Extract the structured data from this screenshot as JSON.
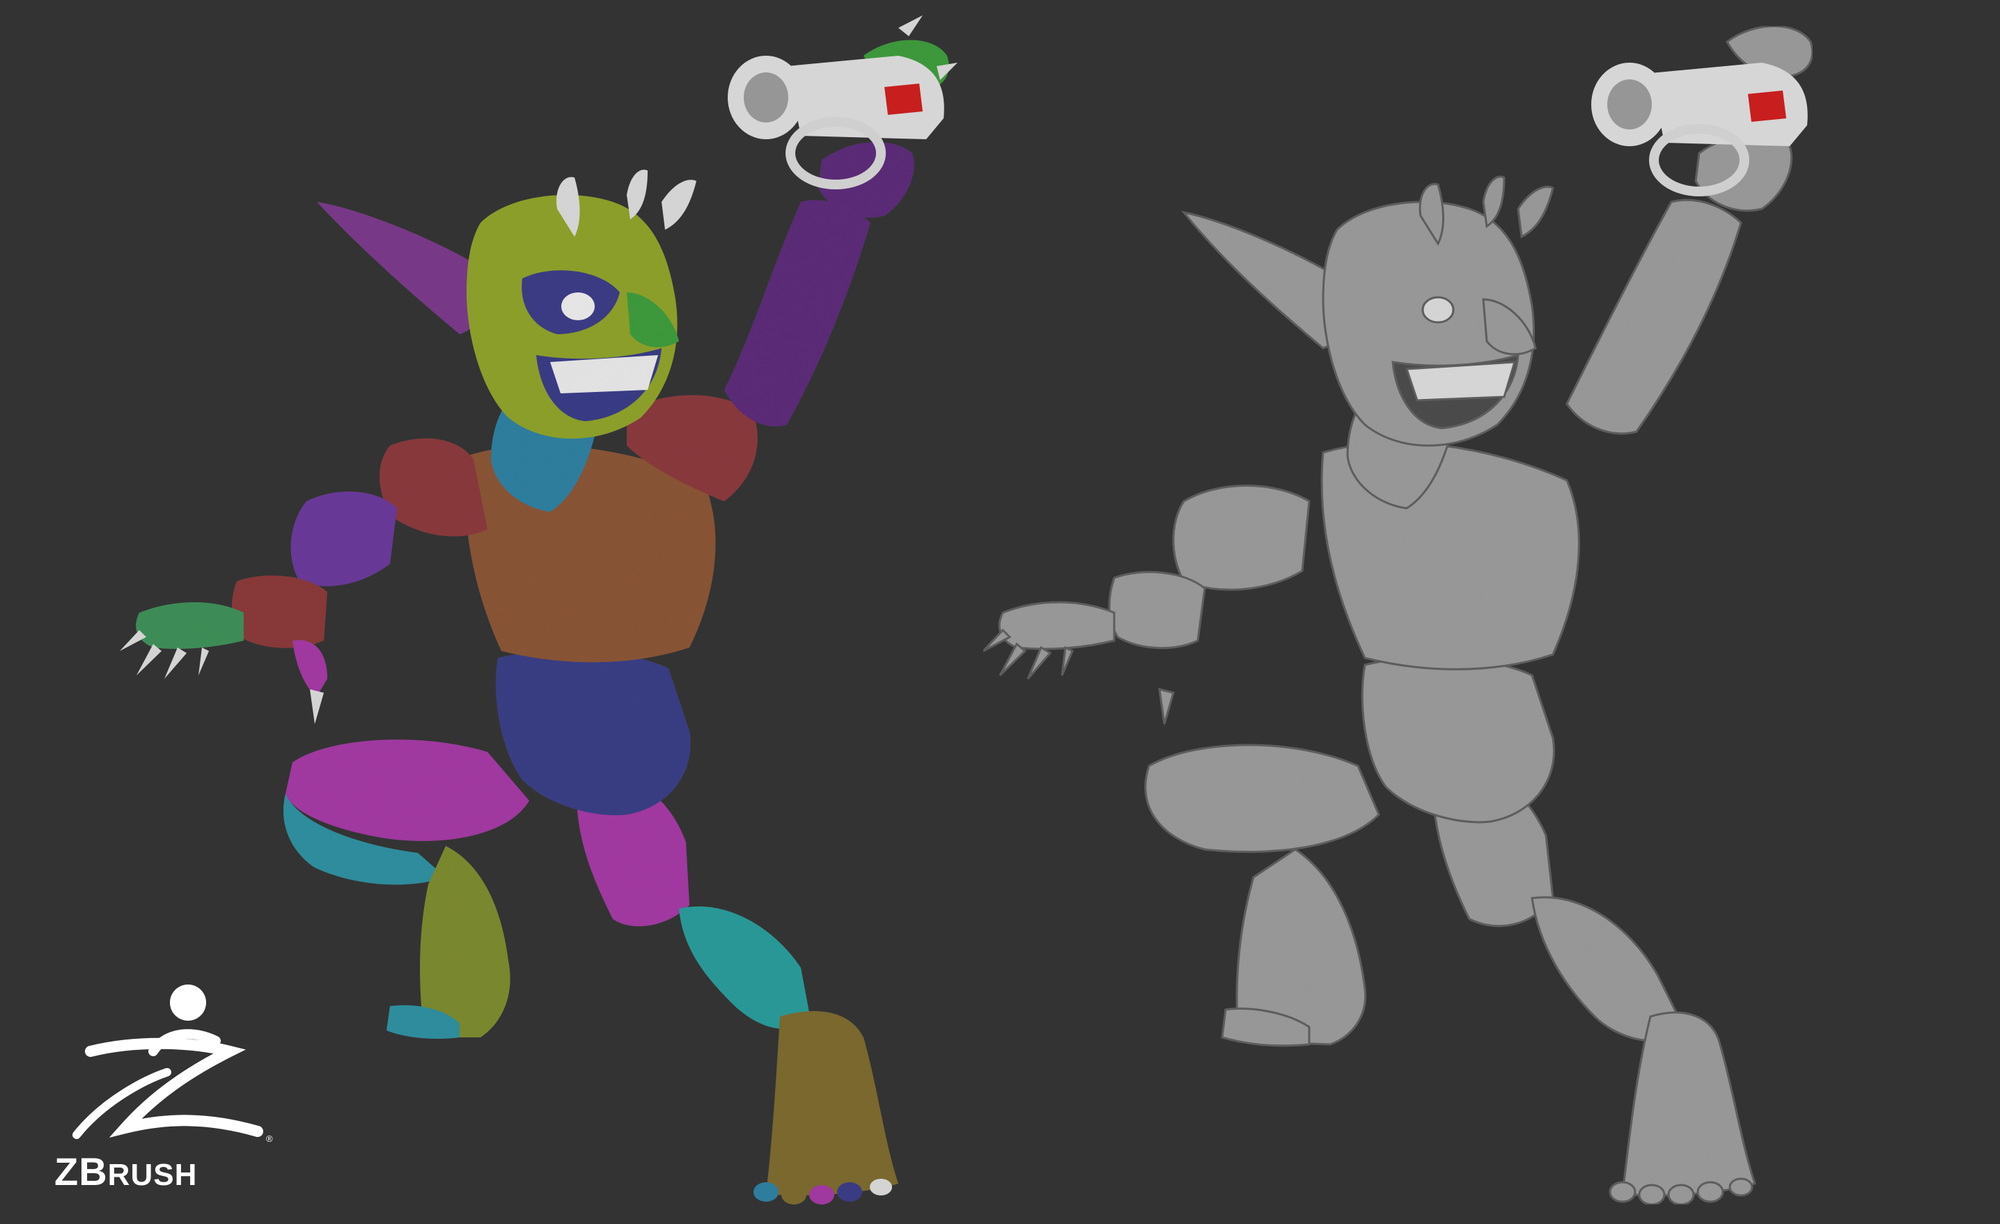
{
  "scene": {
    "background": "#333333",
    "left_model": {
      "name": "goblin-polygroups",
      "palette": {
        "head": "#8ea12a",
        "ear": "#7a3a8a",
        "eye_ring": "#3b3c86",
        "nose": "#3f9a3c",
        "neck": "#2f7fa0",
        "chest": "#8a5535",
        "shoulder": "#8a3a3d",
        "arm": "#5c2d78",
        "forearm": "#6a3a9a",
        "wrist": "#8a3a3a",
        "hand": "#3f8f59",
        "pelvis": "#3a3f85",
        "thigh": "#a33aa3",
        "knee": "#2f8f9f",
        "shin_back": "#7c8a30",
        "shin_front": "#a33aa3",
        "ankle": "#2a9a9a",
        "foot": "#7d6a2e",
        "horn": "#d8d8d8",
        "teeth": "#e6e6e6"
      }
    },
    "right_model": {
      "name": "goblin-sculpt-clay",
      "palette": {
        "clay": "#9a9a9a",
        "clay_light": "#c9c9c9",
        "clay_dark": "#5f5f5f"
      }
    },
    "prop": {
      "name": "hand-held-device",
      "palette": {
        "body": "#d6d6d6",
        "accent": "#c81e1e",
        "dark": "#6a6a6a"
      }
    }
  },
  "logo": {
    "icon": "zbrush-figure-icon",
    "wordmark_first": "Z",
    "wordmark_second": "B",
    "wordmark_rest": "RUSH",
    "registered": "®"
  }
}
